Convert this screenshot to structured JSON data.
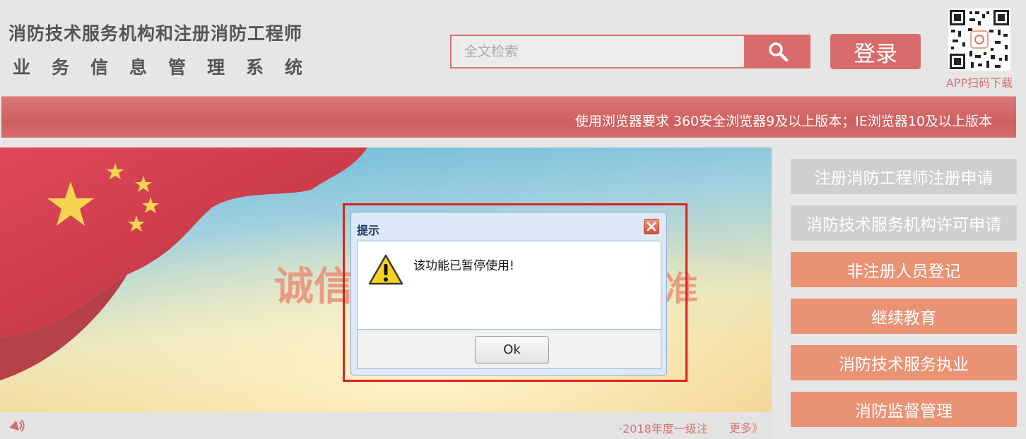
{
  "header": {
    "title_line1": "消防技术服务机构和注册消防工程师",
    "title_line2": "业务信息管理系统",
    "search_placeholder": "全文检索",
    "login_label": "登录",
    "qr_label": "APP扫码下载"
  },
  "notice": {
    "text": "使用浏览器要求 360安全浏览器9及以上版本；IE浏览器10及以上版本"
  },
  "banner": {
    "slogan_left": "诚信",
    "slogan_right": "准",
    "news_text": "·2018年度一级注",
    "more_label": "更多》"
  },
  "sidebar": {
    "items": [
      {
        "label": "注册消防工程师注册申请"
      },
      {
        "label": "消防技术服务机构许可申请"
      },
      {
        "label": "非注册人员登记"
      },
      {
        "label": "继续教育"
      },
      {
        "label": "消防技术服务执业"
      },
      {
        "label": "消防监督管理"
      }
    ]
  },
  "dialog": {
    "title": "提示",
    "message": "该功能已暂停使用!",
    "ok_label": "Ok"
  },
  "colors": {
    "accent": "#d86c6c",
    "side_orange": "#ea9274",
    "side_gray": "#cfcfcf",
    "alert_border": "#e02020"
  },
  "icons": [
    "search-icon",
    "qr-code-icon",
    "warning-icon",
    "close-icon",
    "speaker-icon"
  ]
}
